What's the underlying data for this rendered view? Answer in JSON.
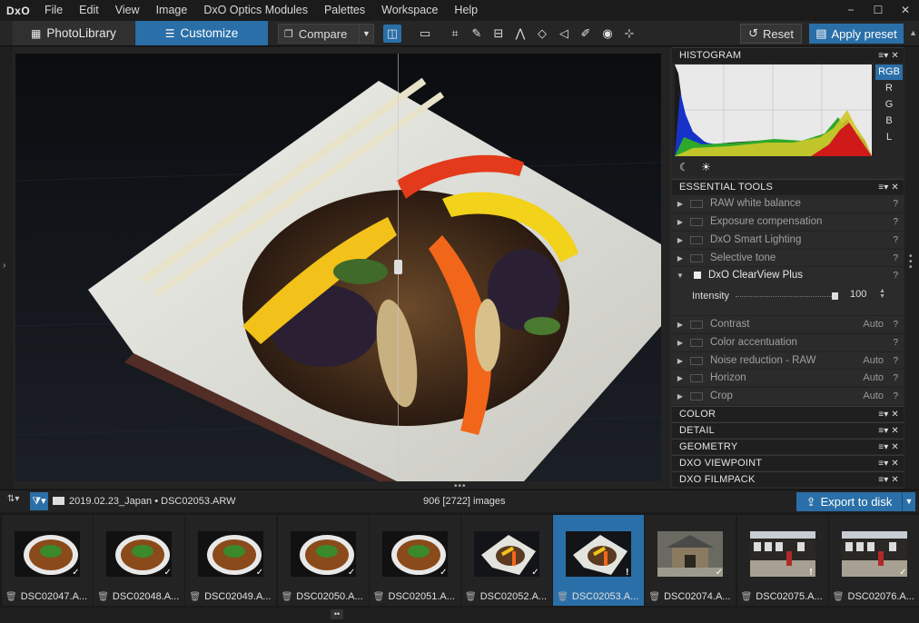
{
  "app": {
    "logo": "DxO",
    "menu": [
      "File",
      "Edit",
      "View",
      "Image",
      "DxO Optics Modules",
      "Palettes",
      "Workspace",
      "Help"
    ],
    "window_controls": [
      "−",
      "☐",
      "✕"
    ]
  },
  "toolbar": {
    "tab_photolibrary": "PhotoLibrary",
    "tab_customize": "Customize",
    "compare": "Compare",
    "reset": "Reset",
    "apply_preset": "Apply preset"
  },
  "histogram": {
    "title": "HISTOGRAM",
    "channels": [
      "RGB",
      "R",
      "G",
      "B",
      "L"
    ],
    "selected_channel": "RGB"
  },
  "essential_tools": {
    "title": "ESSENTIAL TOOLS",
    "tools": [
      {
        "label": "RAW white balance",
        "value": ""
      },
      {
        "label": "Exposure compensation",
        "value": ""
      },
      {
        "label": "DxO Smart Lighting",
        "value": ""
      },
      {
        "label": "Selective tone",
        "value": ""
      },
      {
        "label": "DxO ClearView Plus",
        "value": ""
      },
      {
        "label": "Contrast",
        "value": "Auto"
      },
      {
        "label": "Color accentuation",
        "value": ""
      },
      {
        "label": "Noise reduction - RAW",
        "value": "Auto"
      },
      {
        "label": "Horizon",
        "value": "Auto"
      },
      {
        "label": "Crop",
        "value": "Auto"
      }
    ],
    "clearview": {
      "slider_label": "Intensity",
      "value": "100",
      "fraction": 1.0
    }
  },
  "palettes": [
    "COLOR",
    "DETAIL",
    "GEOMETRY",
    "DXO VIEWPOINT",
    "DXO FILMPACK"
  ],
  "filmbar": {
    "folder": "2019.02.23_Japan",
    "separator": "•",
    "file": "DSC02053.ARW",
    "count": "906 [2722] images",
    "export": "Export to disk"
  },
  "thumbnails": [
    {
      "label": "DSC02047.A...",
      "kind": "ramen",
      "badge": "✓"
    },
    {
      "label": "DSC02048.A...",
      "kind": "ramen",
      "badge": "✓"
    },
    {
      "label": "DSC02049.A...",
      "kind": "ramen",
      "badge": "✓"
    },
    {
      "label": "DSC02050.A...",
      "kind": "ramen",
      "badge": "✓"
    },
    {
      "label": "DSC02051.A...",
      "kind": "ramen",
      "badge": "✓"
    },
    {
      "label": "DSC02052.A...",
      "kind": "plate",
      "badge": "✓"
    },
    {
      "label": "DSC02053.A...",
      "kind": "plate",
      "badge": "!",
      "selected": true
    },
    {
      "label": "DSC02074.A...",
      "kind": "temple",
      "badge": "✓"
    },
    {
      "label": "DSC02075.A...",
      "kind": "street",
      "badge": "!"
    },
    {
      "label": "DSC02076.A...",
      "kind": "street",
      "badge": "✓"
    }
  ],
  "colors": {
    "accent": "#2a6fa8",
    "panel": "#282828",
    "background": "#1c1c1c"
  }
}
